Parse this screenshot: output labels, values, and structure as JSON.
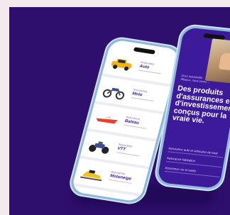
{
  "phone_left": {
    "items": [
      {
        "small": "Assurance",
        "label": "Auto",
        "icon": "car-icon"
      },
      {
        "small": "Assurance",
        "label": "Moto",
        "icon": "motorcycle-icon"
      },
      {
        "small": "Assurance",
        "label": "Bateau",
        "icon": "boat-icon"
      },
      {
        "small": "Assurance",
        "label": "VTT",
        "icon": "atv-icon"
      },
      {
        "small": "Assurance",
        "label": "Motoneige",
        "icon": "snowmobile-icon"
      }
    ]
  },
  "phone_right": {
    "small_text": "Chez Industrielle Alliance, nous avons ...",
    "headline": "Des produits d'assurances et d'investissement conçus pour la vraie vie.",
    "links": [
      "Assurance auto et véhicules de loisir",
      "Assurance habitation",
      "Assurance vie et santé"
    ]
  },
  "colors": {
    "background": "#2e0f6e",
    "screen_right": "#3d1a9a",
    "frame": "#8fb7d8"
  }
}
